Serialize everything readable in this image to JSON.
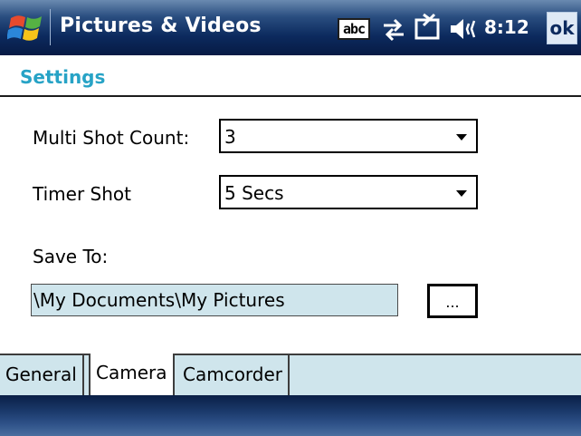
{
  "titlebar": {
    "app_title": "Pictures & Videos",
    "input_indicator": "abc",
    "clock": "8:12",
    "ok_label": "ok",
    "icons": [
      "windows-start-logo",
      "connectivity-icon",
      "battery-icon",
      "volume-icon"
    ]
  },
  "page": {
    "heading": "Settings",
    "accent_color": "#27a3c6"
  },
  "form": {
    "multi_shot_label": "Multi Shot Count:",
    "multi_shot_value": "3",
    "timer_shot_label": "Timer Shot",
    "timer_shot_value": "5 Secs",
    "save_to_label": "Save To:",
    "save_to_value": "\\My Documents\\My Pictures",
    "browse_label": "..."
  },
  "tabs": [
    {
      "label": "General",
      "active": false
    },
    {
      "label": "Camera",
      "active": true
    },
    {
      "label": "Camcorder",
      "active": false
    }
  ]
}
